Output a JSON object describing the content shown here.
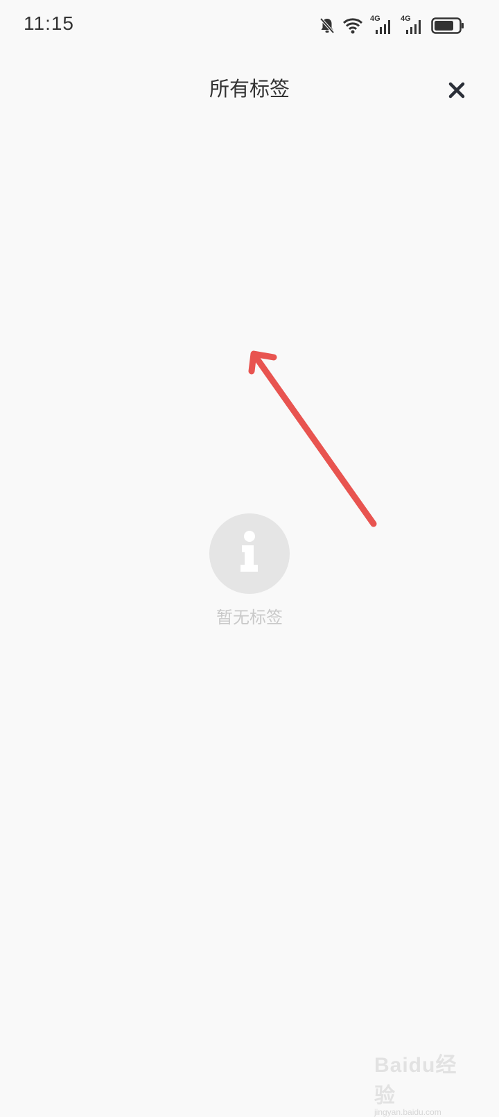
{
  "status_bar": {
    "time": "11:15",
    "icons": [
      "bell-off-icon",
      "wifi-icon",
      "signal-4g-icon",
      "signal-4g-icon",
      "battery-icon"
    ],
    "network_label_1": "4G",
    "network_label_2": "4G"
  },
  "header": {
    "title": "所有标签",
    "close_icon": "close-icon"
  },
  "empty_state": {
    "icon": "info-icon",
    "message": "暂无标签"
  },
  "annotation": {
    "color": "#e85450"
  },
  "watermark": {
    "logo_text": "Baidu经验",
    "sub_text": "jingyan.baidu.com"
  }
}
